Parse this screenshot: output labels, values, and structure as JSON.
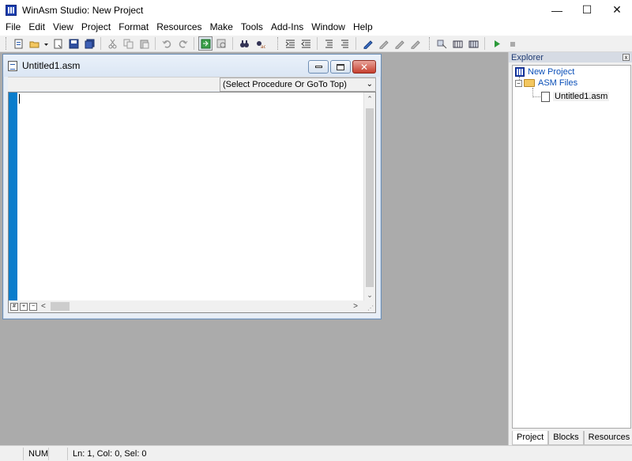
{
  "window": {
    "title": "WinAsm Studio: New Project"
  },
  "controls": {
    "minimize": "—",
    "maximize": "☐",
    "close": "✕"
  },
  "menu": [
    {
      "label": "File"
    },
    {
      "label": "Edit"
    },
    {
      "label": "View"
    },
    {
      "label": "Project"
    },
    {
      "label": "Format"
    },
    {
      "label": "Resources"
    },
    {
      "label": "Make"
    },
    {
      "label": "Tools"
    },
    {
      "label": "Add-Ins"
    },
    {
      "label": "Window"
    },
    {
      "label": "Help"
    }
  ],
  "toolbar": {
    "icons": [
      "new-file-icon",
      "open-folder-icon",
      "dropdown-icon",
      "new-document-icon",
      "save-icon",
      "save-all-icon",
      "cut-icon",
      "copy-icon",
      "paste-icon",
      "undo-icon",
      "redo-icon",
      "goto-icon",
      "find-icon",
      "find-next-icon",
      "replace-icon",
      "indent-icon",
      "outdent-icon",
      "comment-icon",
      "uncomment-icon",
      "bookmark-icon",
      "next-bookmark-icon",
      "prev-bookmark-icon",
      "clear-bookmark-icon",
      "link-icon",
      "assemble-icon",
      "build-icon",
      "run-icon",
      "stop-icon"
    ]
  },
  "document": {
    "title": "Untitled1.asm",
    "procedure_combo": "(Select Procedure Or GoTo Top)"
  },
  "explorer": {
    "title": "Explorer",
    "close": "x",
    "tree": {
      "project": "New Project",
      "folder": "ASM Files",
      "file": "Untitled1.asm"
    },
    "tabs": [
      {
        "label": "Project"
      },
      {
        "label": "Blocks"
      },
      {
        "label": "Resources"
      }
    ]
  },
  "status": {
    "num": "NUM",
    "position": "Ln: 1, Col: 0, Sel: 0"
  },
  "colors": {
    "gutter": "#0a7dcc",
    "mdi_background": "#ababab",
    "tree_link": "#0a4fb8"
  }
}
